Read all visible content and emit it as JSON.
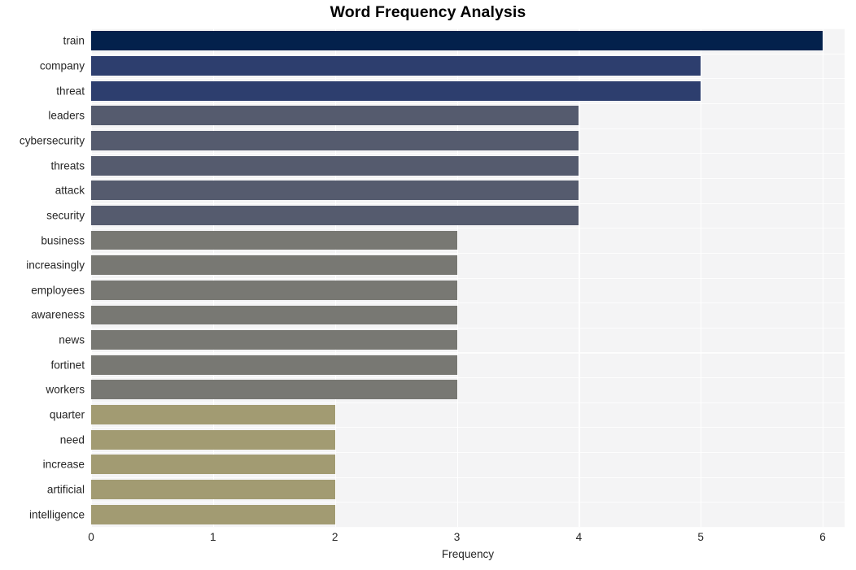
{
  "chart_data": {
    "type": "bar",
    "orientation": "horizontal",
    "title": "Word Frequency Analysis",
    "xlabel": "Frequency",
    "ylabel": "",
    "categories": [
      "train",
      "company",
      "threat",
      "leaders",
      "cybersecurity",
      "threats",
      "attack",
      "security",
      "business",
      "increasingly",
      "employees",
      "awareness",
      "news",
      "fortinet",
      "workers",
      "quarter",
      "need",
      "increase",
      "artificial",
      "intelligence"
    ],
    "values": [
      6,
      5,
      5,
      4,
      4,
      4,
      4,
      4,
      3,
      3,
      3,
      3,
      3,
      3,
      3,
      2,
      2,
      2,
      2,
      2
    ],
    "bar_colors": [
      "#03214c",
      "#2d3e6e",
      "#2d3e6e",
      "#555b6e",
      "#555b6e",
      "#555b6e",
      "#555b6e",
      "#555b6e",
      "#787873",
      "#787873",
      "#787873",
      "#787873",
      "#787873",
      "#787873",
      "#787873",
      "#a29b72",
      "#a29b72",
      "#a29b72",
      "#a29b72",
      "#a29b72"
    ],
    "xlim": [
      0,
      6.18
    ],
    "xticks": [
      0,
      1,
      2,
      3,
      4,
      5,
      6
    ],
    "xtick_labels": [
      "0",
      "1",
      "2",
      "3",
      "4",
      "5",
      "6"
    ],
    "grid": true,
    "legend": null,
    "plot_background": "#f4f4f5",
    "gridline_color": "#ffffff",
    "figure_background": "#ffffff",
    "text_color": "#262626"
  }
}
